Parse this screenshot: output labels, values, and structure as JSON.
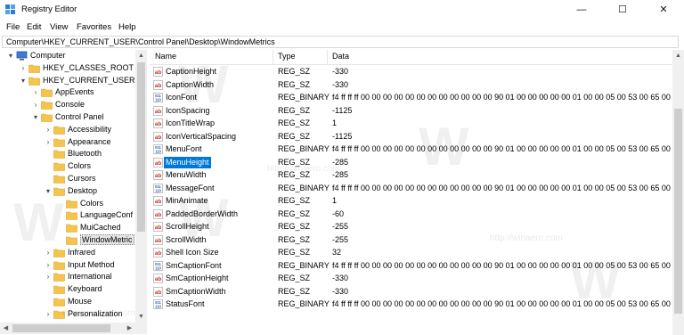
{
  "window": {
    "title": "Registry Editor",
    "minimize": "—",
    "maximize": "☐",
    "close": "✕"
  },
  "menu": [
    "File",
    "Edit",
    "View",
    "Favorites",
    "Help"
  ],
  "address": "Computer\\HKEY_CURRENT_USER\\Control Panel\\Desktop\\WindowMetrics",
  "tree": [
    {
      "label": "Computer",
      "twisty": "▾",
      "type": "computer"
    },
    {
      "label": "HKEY_CLASSES_ROOT",
      "twisty": "›",
      "type": "folder"
    },
    {
      "label": "HKEY_CURRENT_USER",
      "twisty": "▾",
      "type": "folder"
    },
    {
      "label": "AppEvents",
      "twisty": "›",
      "type": "folder"
    },
    {
      "label": "Console",
      "twisty": "›",
      "type": "folder"
    },
    {
      "label": "Control Panel",
      "twisty": "▾",
      "type": "folder"
    },
    {
      "label": "Accessibility",
      "twisty": "›",
      "type": "folder"
    },
    {
      "label": "Appearance",
      "twisty": "›",
      "type": "folder"
    },
    {
      "label": "Bluetooth",
      "twisty": "",
      "type": "folder"
    },
    {
      "label": "Colors",
      "twisty": "",
      "type": "folder"
    },
    {
      "label": "Cursors",
      "twisty": "",
      "type": "folder"
    },
    {
      "label": "Desktop",
      "twisty": "▾",
      "type": "folder"
    },
    {
      "label": "Colors",
      "twisty": "",
      "type": "folder"
    },
    {
      "label": "LanguageConf",
      "twisty": "",
      "type": "folder"
    },
    {
      "label": "MuiCached",
      "twisty": "",
      "type": "folder"
    },
    {
      "label": "WindowMetric",
      "twisty": "",
      "type": "folder",
      "selected": true
    },
    {
      "label": "Infrared",
      "twisty": "›",
      "type": "folder"
    },
    {
      "label": "Input Method",
      "twisty": "›",
      "type": "folder"
    },
    {
      "label": "International",
      "twisty": "›",
      "type": "folder"
    },
    {
      "label": "Keyboard",
      "twisty": "",
      "type": "folder"
    },
    {
      "label": "Mouse",
      "twisty": "",
      "type": "folder"
    },
    {
      "label": "Personalization",
      "twisty": "›",
      "type": "folder"
    }
  ],
  "list": {
    "headers": [
      "Name",
      "Type",
      "Data"
    ],
    "rows": [
      {
        "icon": "string-value-icon",
        "name": "CaptionHeight",
        "type": "REG_SZ",
        "data": "-330"
      },
      {
        "icon": "string-value-icon",
        "name": "CaptionWidth",
        "type": "REG_SZ",
        "data": "-330"
      },
      {
        "icon": "binary-value-icon",
        "name": "IconFont",
        "type": "REG_BINARY",
        "data": "f4 ff ff ff 00 00 00 00 00 00 00 00 00 00 00 00 90 01 00 00 00 00 00 01 00 00 05 00 53 00 65 00 67 00"
      },
      {
        "icon": "string-value-icon",
        "name": "IconSpacing",
        "type": "REG_SZ",
        "data": "-1125"
      },
      {
        "icon": "string-value-icon",
        "name": "IconTitleWrap",
        "type": "REG_SZ",
        "data": "1"
      },
      {
        "icon": "string-value-icon",
        "name": "IconVerticalSpacing",
        "type": "REG_SZ",
        "data": "-1125"
      },
      {
        "icon": "binary-value-icon",
        "name": "MenuFont",
        "type": "REG_BINARY",
        "data": "f4 ff ff ff 00 00 00 00 00 00 00 00 00 00 00 00 90 01 00 00 00 00 00 01 00 00 05 00 53 00 65 00 67 00"
      },
      {
        "icon": "string-value-icon",
        "name": "MenuHeight",
        "type": "REG_SZ",
        "data": "-285",
        "selected": true
      },
      {
        "icon": "string-value-icon",
        "name": "MenuWidth",
        "type": "REG_SZ",
        "data": "-285"
      },
      {
        "icon": "binary-value-icon",
        "name": "MessageFont",
        "type": "REG_BINARY",
        "data": "f4 ff ff ff 00 00 00 00 00 00 00 00 00 00 00 00 90 01 00 00 00 00 00 01 00 00 05 00 53 00 65 00 67 00"
      },
      {
        "icon": "string-value-icon",
        "name": "MinAnimate",
        "type": "REG_SZ",
        "data": "1"
      },
      {
        "icon": "string-value-icon",
        "name": "PaddedBorderWidth",
        "type": "REG_SZ",
        "data": "-60"
      },
      {
        "icon": "string-value-icon",
        "name": "ScrollHeight",
        "type": "REG_SZ",
        "data": "-255"
      },
      {
        "icon": "string-value-icon",
        "name": "ScrollWidth",
        "type": "REG_SZ",
        "data": "-255"
      },
      {
        "icon": "string-value-icon",
        "name": "Shell Icon Size",
        "type": "REG_SZ",
        "data": "32"
      },
      {
        "icon": "binary-value-icon",
        "name": "SmCaptionFont",
        "type": "REG_BINARY",
        "data": "f4 ff ff ff 00 00 00 00 00 00 00 00 00 00 00 00 90 01 00 00 00 00 00 01 00 00 05 00 53 00 65 00 67 00"
      },
      {
        "icon": "string-value-icon",
        "name": "SmCaptionHeight",
        "type": "REG_SZ",
        "data": "-330"
      },
      {
        "icon": "string-value-icon",
        "name": "SmCaptionWidth",
        "type": "REG_SZ",
        "data": "-330"
      },
      {
        "icon": "binary-value-icon",
        "name": "StatusFont",
        "type": "REG_BINARY",
        "data": "f4 ff ff ff 00 00 00 00 00 00 00 00 00 00 00 00 90 01 00 00 00 00 00 01 00 00 05 00 53 00 65 00 67 00"
      }
    ]
  },
  "watermark": {
    "logo": "W",
    "url": "http://winaero.com"
  },
  "colors": {
    "selection": "#0078d7",
    "folder": "#f5c44d",
    "string_icon": "#c0392b",
    "binary_icon": "#2b5ea7"
  }
}
